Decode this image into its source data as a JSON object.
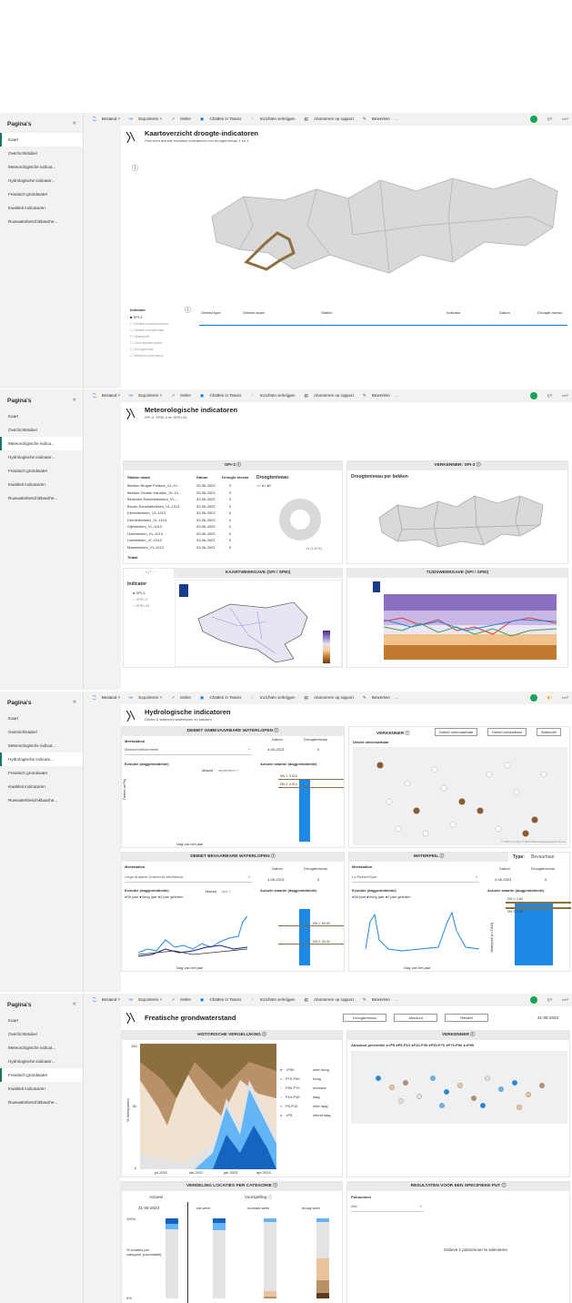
{
  "sidebar": {
    "title": "Pagina's",
    "items": [
      "Kaart",
      "Overzichtstabel",
      "Meteorologische indicat...",
      "Hydrologische indicator...",
      "Freatisch grondwater",
      "Kwaliteit indicatoren",
      "Ruwwaterbeschikbaarhe..."
    ]
  },
  "toolbar": {
    "bestand": "Bestand",
    "exporteren": "Exporteren",
    "delen": "Delen",
    "chatten": "Chatten in Teams",
    "inzichten": "Inzichten verkrijgen",
    "abonneren": "Abonneren op rapport",
    "bewerken": "Bewerken",
    "more": "···"
  },
  "s1": {
    "sidebar_items": [
      "Kaart",
      "Overzichtstabel",
      "Meteorologische indicat...",
      "Hydrologische indicator...",
      "Freatisch grondwater",
      "Kwaliteit indicatoren",
      "Ruwwaterbeschikbaarhe..."
    ],
    "title": "Kaartoverzicht droogte-indicatoren",
    "subtitle": "Overzicht actuele toestand indicatoren met droogteniveau 1 en 2",
    "info": "ⓘ",
    "indicator_label": "Indicator",
    "indicators": [
      "SPI-3",
      "Debiet onbevaarbaar",
      "Debiet bevaarbaar",
      "Waterpeil",
      "Grondwaterstand",
      "Zoutgehalte",
      "Watertemperatuur"
    ],
    "cols": [
      "Gebied type",
      "Gebied naam",
      "Station",
      "Indicator",
      "Datum",
      "Droogte-niveau"
    ]
  },
  "s2": {
    "sidebar_items": [
      "Kaart",
      "Overzichtstabel",
      "Meteorologische indica...",
      "Hydrologische indicator...",
      "Freatisch grondwater",
      "Kwaliteit indicatoren",
      "Ruwwaterbeschikbaarhe..."
    ],
    "title": "Meteorologische indicatoren",
    "subtitle": "SPI-3, SPEI-3 en SPEI-24",
    "spi_title": "SPI-3 ⓘ",
    "verkenner_title": "VERKENNER: SPI-3 ⓘ",
    "table_cols": [
      "Station naam",
      "Datum",
      "Droogte-niveau"
    ],
    "rows": [
      [
        "Bekken Brugse Polders_VL-10...",
        "03-06-2023",
        "0"
      ],
      [
        "Bekken Gentse Kanalen_VL-10...",
        "03-06-2023",
        "0"
      ],
      [
        "Beneden-Scheldebekken_VL-...",
        "03-06-2023",
        "0"
      ],
      [
        "Boven-Scheldebekken_VL-1013",
        "03-06-2023",
        "0"
      ],
      [
        "Demerbekken_VL-1013",
        "03-06-2023",
        "0"
      ],
      [
        "Denderbekken_VL-1013",
        "03-06-2023",
        "0"
      ],
      [
        "Dijlebekken_VL-1013",
        "03-06-2023",
        "0"
      ],
      [
        "IJzerbekken_VL-1013",
        "03-06-2023",
        "0"
      ],
      [
        "Leiebekken_VL-1013",
        "03-06-2023",
        "0"
      ],
      [
        "Maasbekken_VL-1013",
        "03-06-2023",
        "0"
      ]
    ],
    "total": "Totaal",
    "donut_title": "Droogteniveau",
    "donut_legend": [
      "0",
      "1",
      "2"
    ],
    "donut_label": "11 (100%)",
    "map_title": "Droogteniveau per bekken",
    "kaart_title": "KAARTWEERGAVE (SPI / SPEI)",
    "tijd_title": "TIJDSWEERGAVE (SPI / SPEI)",
    "indicator_label": "Indicator",
    "radio": [
      "SPI-3",
      "SPEI-3",
      "SPEI-24"
    ]
  },
  "s3": {
    "sidebar_items": [
      "Kaart",
      "Overzichtstabel",
      "Meteorologische indicat...",
      "Hydrologische indicato...",
      "Freatisch grondwater",
      "Kwaliteit indicatoren",
      "Ruwwaterbeschikbaarhe..."
    ],
    "title": "Hydrologische indicatoren",
    "subtitle": "Debiet & waterpeil waterlopen en kanalen",
    "onbev_title": "DEBIET ONBEVAARBARE WATERLOPEN ⓘ",
    "meetstation": "Meetstation",
    "onbev_station": "Maarkem/Molenbeek",
    "datum": "Datum",
    "droogteniveau": "Droogteniveau",
    "onbev_date": "4-06-2023",
    "onbev_level": "0",
    "evolutie": "Evolutie (daggemiddelde)",
    "actuele": "Actuele waarde (daggemiddelde)",
    "maand": "Maand",
    "onbev_month": "september",
    "dag": "Dag van het jaar",
    "debiet": "Debiet (m³/s)",
    "dn1": "DN 1: 0.015",
    "dn2": "DN 2: 0.013",
    "verkenner": "VERKENNER ⓘ",
    "vbtn": [
      "Debiet onbevaarbaar",
      "Debiet bevaarbaar",
      "Waterpeil"
    ],
    "vmap_label": "Debiet onbevaarbaar",
    "bev_title": "DEBIET BEVAARBARE WATERLOPEN ⓘ",
    "bev_station": "Liege Ahaavie Ornerkeld zeh/Meuse",
    "bev_date": "4-06-2023",
    "bev_level": "0",
    "bev_month": "juni",
    "legend3": [
      "Dit jaar",
      "Vorig jaar",
      "2 jaar geleden"
    ],
    "wp_title": "WATERPEIL ⓘ",
    "type_label": "Type:",
    "type_val": "Bevaarbaar",
    "wp_station": "Lo-Fintele/Spar",
    "wp_date": "4-06-2023",
    "wp_level": "0",
    "waterpeil_axis": "Waterpeil (m TAW)",
    "bev_dn1": "DN 1: 60.00",
    "bev_dn2": "DN 2: 30.00",
    "wp_dn1": "DN 1: 2.84",
    "wp_dn2": "DN 2: 2.34",
    "copyright": "© 2023 TomTom © 2023 Microsoft Corporation Terms"
  },
  "s4": {
    "sidebar_items": [
      "Kaart",
      "Overzichtstabel",
      "Meteorologische indicat...",
      "Hydrologische indicator...",
      "Freatisch grondwater",
      "Kwaliteit indicatoren",
      "Ruwwaterbeschikbaarhe..."
    ],
    "title": "Freatische grondwaterstand",
    "btns": [
      "Droogteniveau",
      "Absoluut",
      "Relatief"
    ],
    "date": "31-05-2023",
    "hist_title": "HISTORISCHE VERGELIJKING ⓘ",
    "ylabel": "% Meetpunten",
    "xticks": [
      "jul 2022",
      "okt 2022",
      "jan 2023",
      "apr 2023"
    ],
    "yticks": [
      "100",
      "50",
      "0"
    ],
    "legend": [
      [
        "<P90",
        "zeer hoog"
      ],
      [
        "P70-P90",
        "hoog"
      ],
      [
        "P30-P70",
        "normaal"
      ],
      [
        "P10-P30",
        "laag"
      ],
      [
        "P5-P10",
        "zeer laag"
      ],
      [
        "<P5",
        "uiterst laag"
      ]
    ],
    "verk_title": "VERKENNER ⓘ",
    "verk_legend": "Absoluut percentiel ●<P5 ●P5-P10 ●P10-P30 ●P30-P70 ●P70-P90 ●>P90",
    "verd_title": "VERDELING LOCATIES PER CATEGORIE ⓘ",
    "actueel": "Actueel",
    "voorspelling": "Voorspelling ⓘ",
    "act_date": "31-05-2023",
    "weer": [
      "nat weer",
      "normaal weer",
      "droog weer"
    ],
    "yaxis": "% locaties per categorie (cumulatief)",
    "p100": "100%",
    "p0": "0%",
    "res_title": "RESULTATEN VOOR EEN SPECIFIEKE PUT ⓘ",
    "putnummer": "Putnummer",
    "alle": "Alle",
    "select_msg": "Gelieve 1 putnummer te selecteren"
  },
  "colors": {
    "accent": "#117865",
    "blue": "#1e88e5",
    "brown": "#8d6e3f"
  }
}
